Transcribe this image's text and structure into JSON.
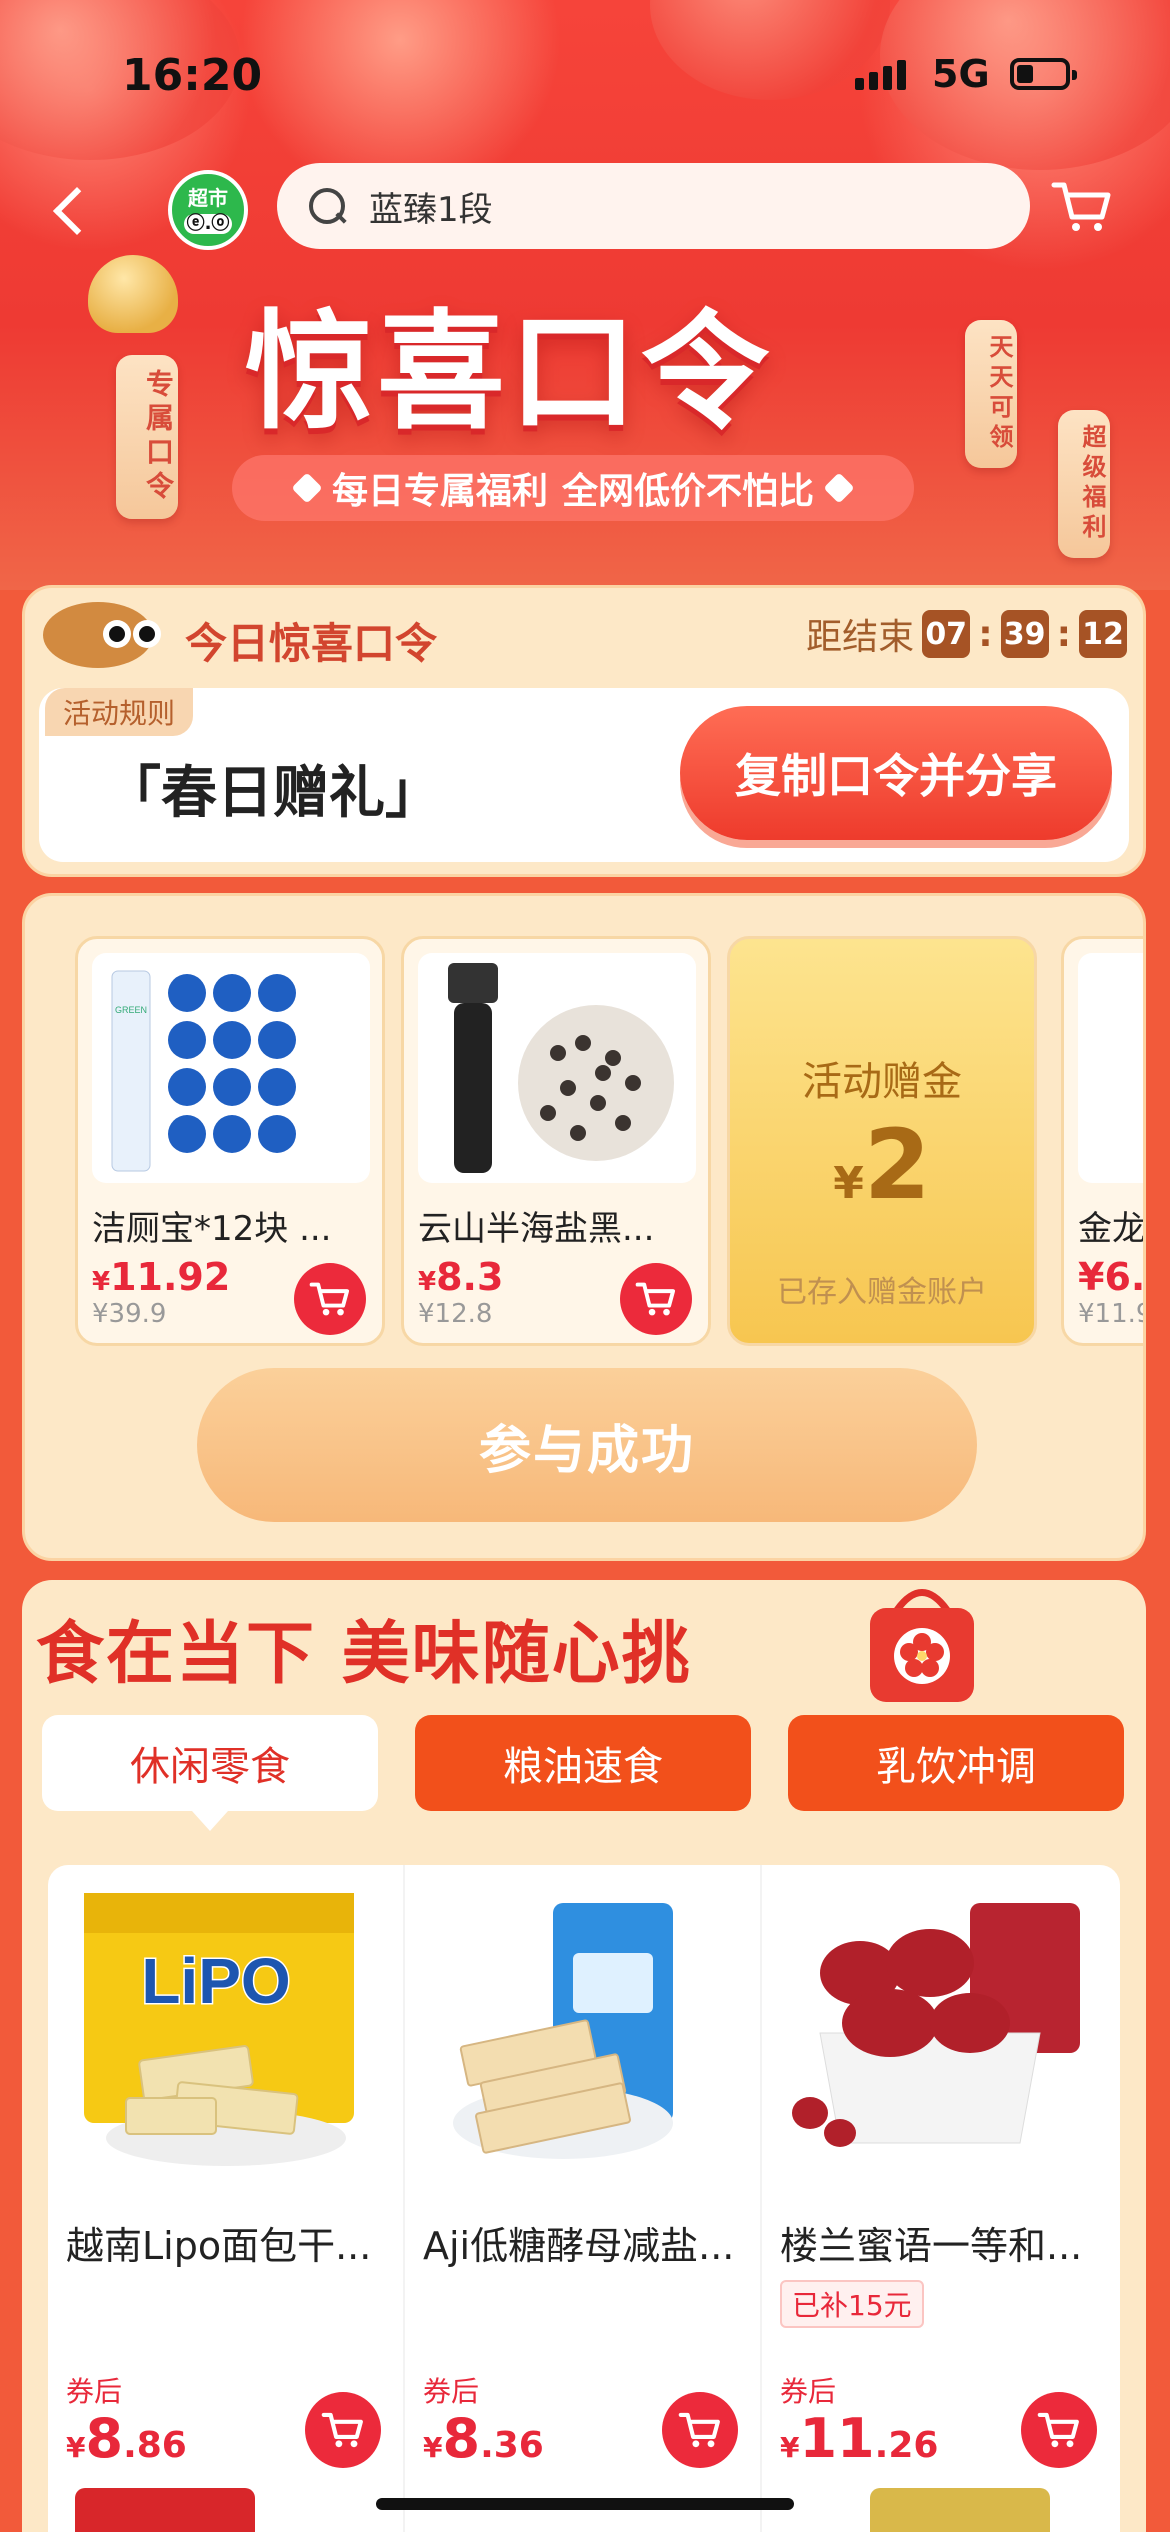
{
  "status_bar": {
    "time": "16:20",
    "network": "5G"
  },
  "header": {
    "market_badge": "超市",
    "market_badge_face": "ⓔ.ⓞ",
    "search_placeholder": "蓝臻1段"
  },
  "hero": {
    "title": "惊喜口令",
    "subtitle_a": "每日专属福利",
    "subtitle_b": "全网低价不怕比",
    "left_tag": "专属口令",
    "right_tag_1": "天天可领",
    "right_tag_2": "超级福利"
  },
  "command": {
    "title": "今日惊喜口令",
    "countdown_label": "距结束",
    "hours": "07",
    "minutes": "39",
    "seconds": "12",
    "rules_link": "活动规则",
    "passphrase": "「春日赠礼」",
    "copy_button": "复制口令并分享"
  },
  "products": [
    {
      "name": "洁厕宝*12块 ...",
      "price_symbol": "¥",
      "price": "11.92",
      "original": "¥39.9"
    },
    {
      "name": "云山半海盐黑...",
      "price_symbol": "¥",
      "price": "8.3",
      "original": "¥12.8"
    }
  ],
  "gift": {
    "title": "活动赠金",
    "symbol": "¥",
    "amount": "2",
    "note": "已存入赠金账户"
  },
  "partial_product": {
    "name": "金龙",
    "price": "¥6.",
    "original": "¥11.9"
  },
  "join_button": "参与成功",
  "food": {
    "title": "食在当下 美味随心挑",
    "tabs": [
      "休闲零食",
      "粮油速食",
      "乳饮冲调"
    ],
    "items": [
      {
        "name": "越南Lipo面包干...",
        "after_label": "券后",
        "symbol": "¥",
        "int": "8",
        "dec": ".86",
        "badge": ""
      },
      {
        "name": "Aji低糖酵母减盐...",
        "after_label": "券后",
        "symbol": "¥",
        "int": "8",
        "dec": ".36",
        "badge": ""
      },
      {
        "name": "楼兰蜜语一等和...",
        "after_label": "券后",
        "symbol": "¥",
        "int": "11",
        "dec": ".26",
        "badge": "已补15元"
      }
    ],
    "lipo_brand": "LiPO"
  },
  "colors": {
    "accent_red": "#ec2a3b",
    "brand_orange": "#f2501b",
    "cream": "#fde8c7"
  }
}
